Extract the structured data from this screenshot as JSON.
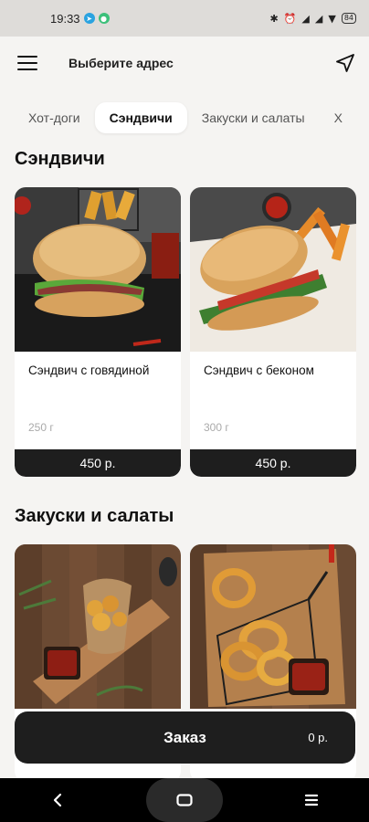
{
  "status_bar": {
    "time": "19:33",
    "battery": "84"
  },
  "header": {
    "address_placeholder": "Выберите адрес",
    "icons": [
      "menu-icon",
      "location-arrow-icon"
    ]
  },
  "tabs": [
    {
      "label": "Хот-доги",
      "active": false
    },
    {
      "label": "Сэндвичи",
      "active": true
    },
    {
      "label": "Закуски и салаты",
      "active": false
    },
    {
      "label": "Х",
      "active": false
    }
  ],
  "sections": [
    {
      "title": "Сэндвичи",
      "items": [
        {
          "name": "Сэндвич с говядиной",
          "weight": "250 г",
          "price": "450 р."
        },
        {
          "name": "Сэндвич с беконом",
          "weight": "300 г",
          "price": "450 р."
        }
      ]
    },
    {
      "title": "Закуски и салаты",
      "items": [
        {
          "name": "",
          "weight": "",
          "price": ""
        },
        {
          "name": "",
          "weight": "",
          "price": ""
        }
      ]
    }
  ],
  "order": {
    "label": "Заказ",
    "total": "0 р."
  },
  "colors": {
    "background": "#f5f4f2",
    "dark": "#1e1e1e",
    "status_bar": "#dedcd9"
  }
}
